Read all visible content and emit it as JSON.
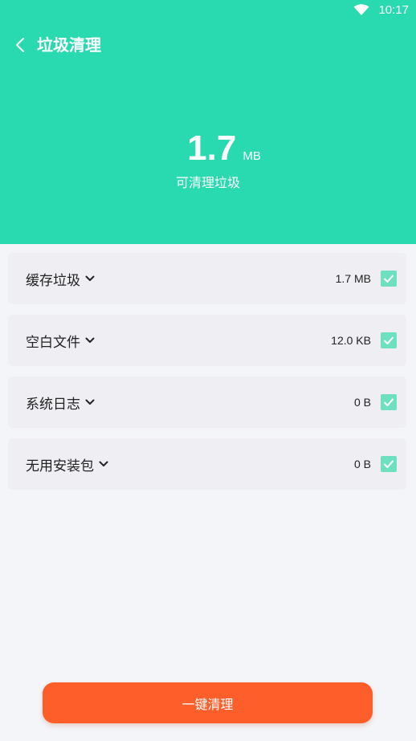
{
  "status_bar": {
    "time": "10:17",
    "wifi_icon": "wifi-icon"
  },
  "nav": {
    "back_icon": "chevron-left-icon",
    "title": "垃圾清理"
  },
  "summary": {
    "size_value": "1.7",
    "size_unit": "MB",
    "caption": "可清理垃圾"
  },
  "items": [
    {
      "label": "缓存垃圾",
      "size": "1.7 MB",
      "checked": true,
      "icon": "chevron-down-icon"
    },
    {
      "label": "空白文件",
      "size": "12.0 KB",
      "checked": true,
      "icon": "chevron-down-icon"
    },
    {
      "label": "系统日志",
      "size": "0 B",
      "checked": true,
      "icon": "chevron-down-icon"
    },
    {
      "label": "无用安装包",
      "size": "0 B",
      "checked": true,
      "icon": "chevron-down-icon"
    }
  ],
  "action": {
    "clean_label": "一键清理"
  },
  "colors": {
    "header": "#29d9b0",
    "checkbox": "#6ee0bf",
    "button": "#fd5e2a",
    "background": "#f4f5f9"
  }
}
